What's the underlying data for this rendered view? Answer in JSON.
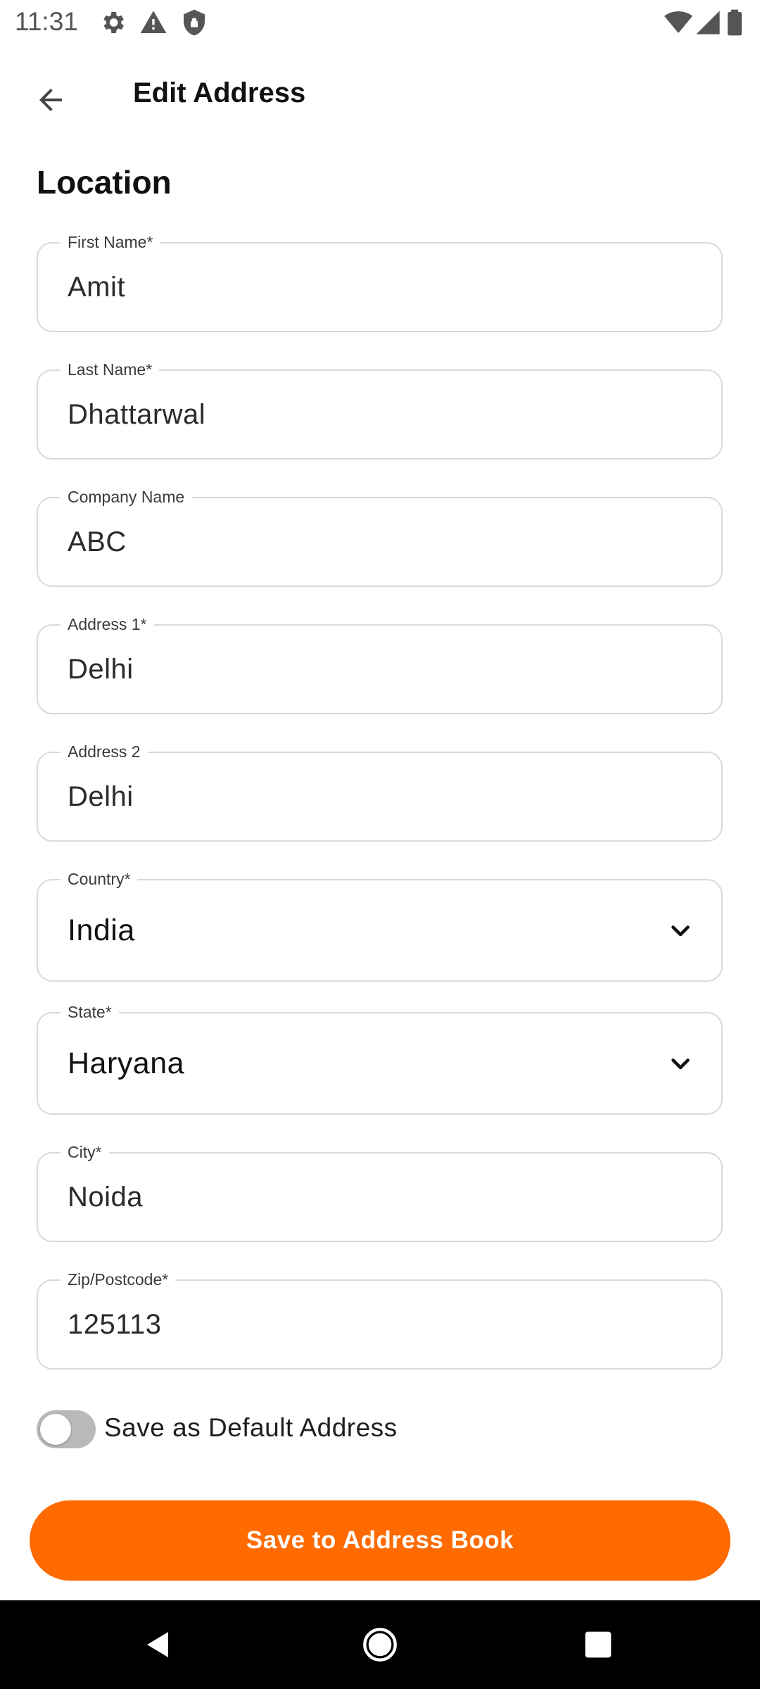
{
  "status_bar": {
    "time": "11:31",
    "left_icons": [
      "settings-icon",
      "warning-icon",
      "shield-icon"
    ],
    "right_icons": [
      "wifi-icon",
      "signal-icon",
      "battery-icon"
    ]
  },
  "header": {
    "title": "Edit Address",
    "back_icon": "arrow-left-icon"
  },
  "section": {
    "title": "Location"
  },
  "fields": {
    "first_name": {
      "label": "First Name*",
      "value": "Amit"
    },
    "last_name": {
      "label": "Last Name*",
      "value": "Dhattarwal"
    },
    "company": {
      "label": "Company Name",
      "value": "ABC"
    },
    "address1": {
      "label": "Address 1*",
      "value": "Delhi"
    },
    "address2": {
      "label": "Address 2",
      "value": "Delhi"
    },
    "country": {
      "label": "Country*",
      "value": "India"
    },
    "state": {
      "label": "State*",
      "value": "Haryana"
    },
    "city": {
      "label": "City*",
      "value": "Noida"
    },
    "zip": {
      "label": "Zip/Postcode*",
      "value": "125113"
    }
  },
  "default_toggle": {
    "label": "Save as Default Address",
    "checked": false
  },
  "actions": {
    "save_label": "Save to Address Book"
  },
  "colors": {
    "accent": "#ff6b00",
    "field_border": "#d9d9d9",
    "toggle_off": "#b9b9b9",
    "nav_bar": "#000000"
  },
  "nav_bar": {
    "icons": [
      "back-triangle-icon",
      "home-circle-icon",
      "recents-square-icon"
    ]
  }
}
